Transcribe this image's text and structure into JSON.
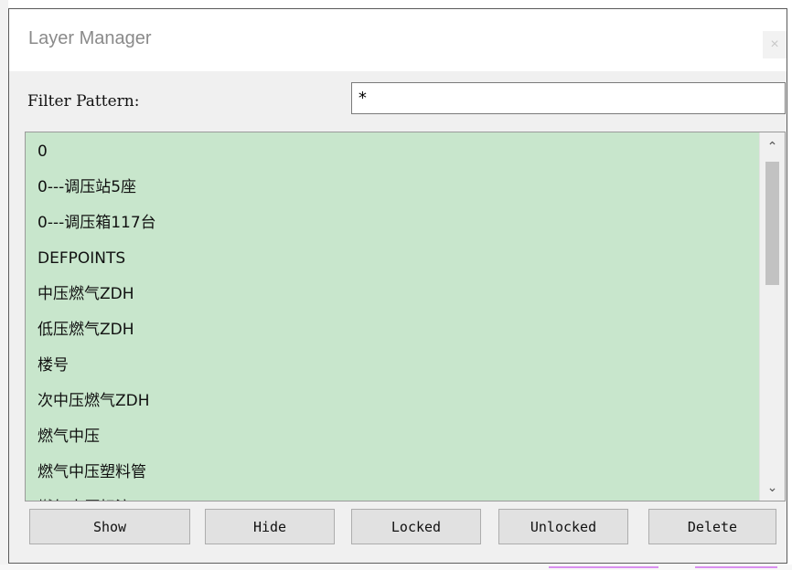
{
  "dialog": {
    "title": "Layer Manager",
    "close_label": "×"
  },
  "filter": {
    "label": "Filter Pattern:",
    "value": "*"
  },
  "layers": [
    "0",
    "0---调压站5座",
    "0---调压箱117台",
    "DEFPOINTS",
    "中压燃气ZDH",
    "低压燃气ZDH",
    "楼号",
    "次中压燃气ZDH",
    "燃气中压",
    "燃气中压塑料管",
    "燃气中压标注"
  ],
  "scrollbar": {
    "up_glyph": "⌃",
    "down_glyph": "⌄"
  },
  "buttons": {
    "show": "Show",
    "hide": "Hide",
    "locked": "Locked",
    "unlocked": "Unlocked",
    "delete": "Delete"
  },
  "colors": {
    "list_background": "#c8e6cc",
    "dialog_background": "#f0f0f0",
    "button_background": "#e1e1e1"
  }
}
